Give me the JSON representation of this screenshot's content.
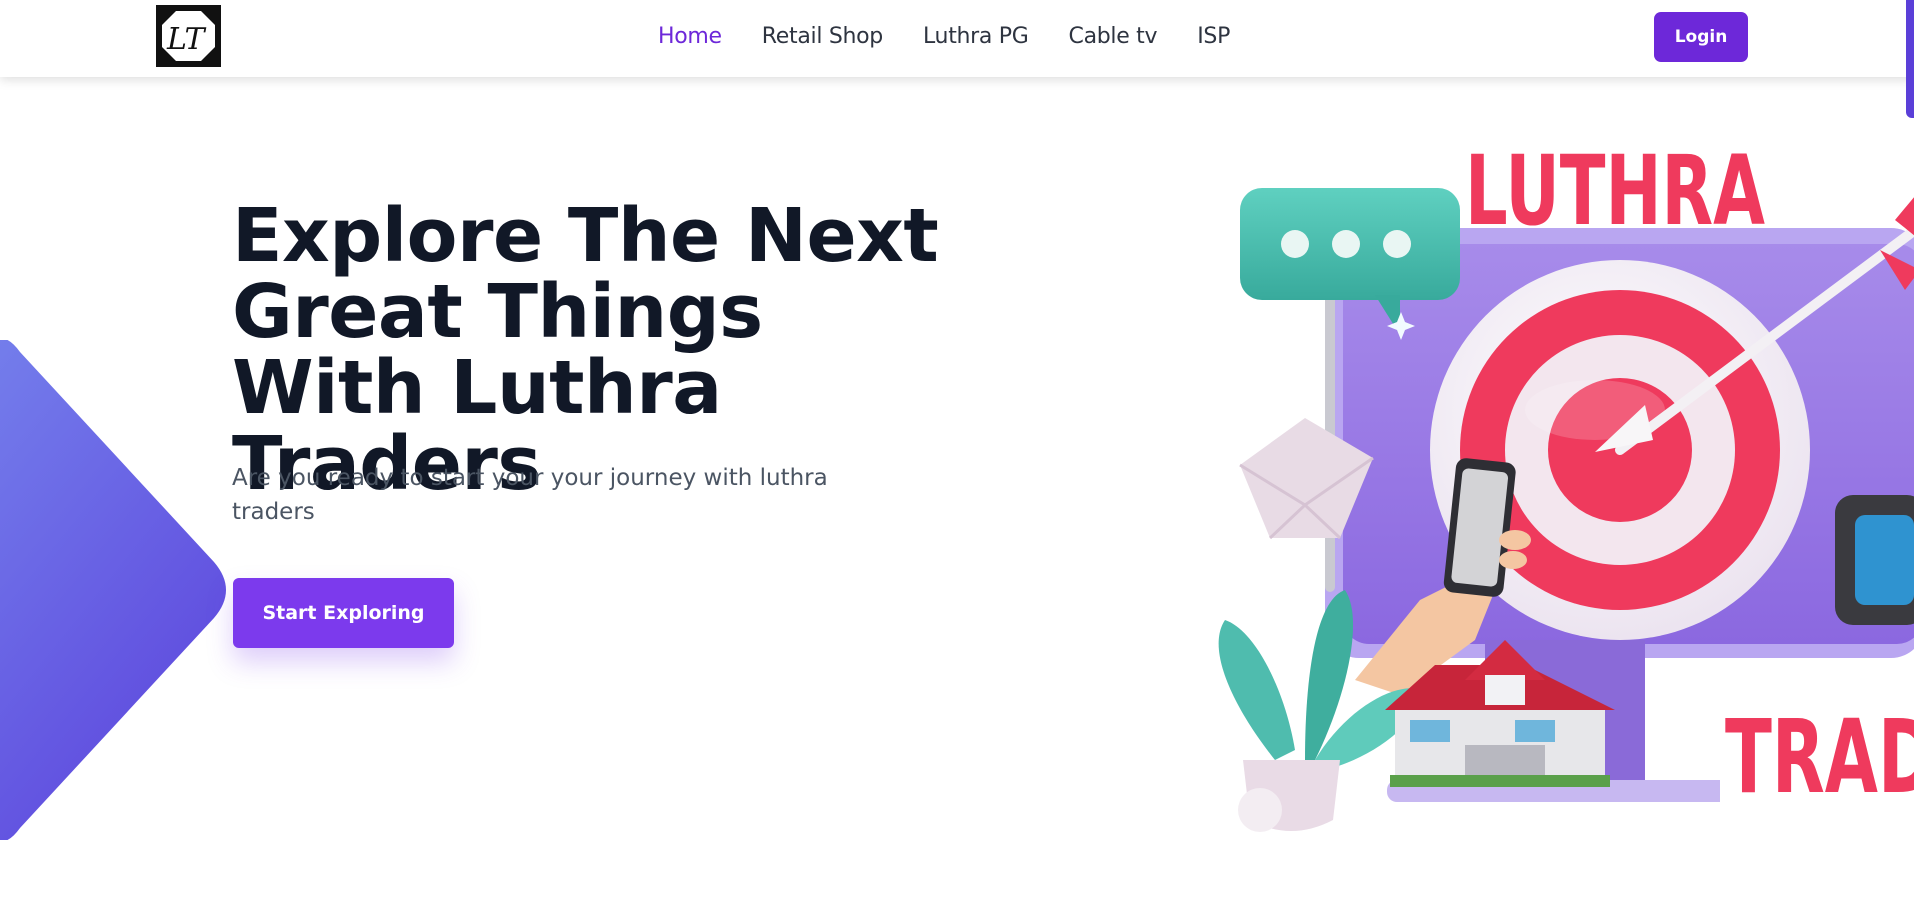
{
  "header": {
    "logo_text": "LT",
    "nav": [
      {
        "label": "Home",
        "active": true
      },
      {
        "label": "Retail Shop",
        "active": false
      },
      {
        "label": "Luthra PG",
        "active": false
      },
      {
        "label": "Cable tv",
        "active": false
      },
      {
        "label": "ISP",
        "active": false
      }
    ],
    "login_label": "Login"
  },
  "hero": {
    "title": "Explore The Next Great Things With Luthra Traders",
    "subtitle": "Are you ready to start your your journey with luthra traders",
    "cta_label": "Start Exploring"
  },
  "illustration": {
    "top_text": "LUTHRA",
    "bottom_text": "TRAD"
  },
  "colors": {
    "accent": "#6d28d9",
    "button": "#7c3aed",
    "brand_red": "#ef3a5d",
    "heading": "#111827",
    "body_text": "#4b5563"
  }
}
